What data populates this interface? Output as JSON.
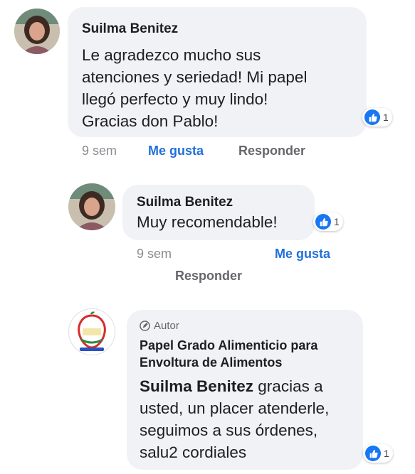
{
  "comments": [
    {
      "author": "Suilma Benitez",
      "lines": [
        "Le agradezco mucho sus",
        "atenciones y seriedad! Mi papel",
        "llegó perfecto y muy lindo!",
        "Gracias don Pablo!"
      ],
      "reaction_count": "1",
      "time": "9 sem",
      "like_label": "Me gusta",
      "reply_label": "Responder"
    },
    {
      "author": "Suilma Benitez",
      "lines": [
        "Muy recomendable!"
      ],
      "reaction_count": "1",
      "time": "9 sem",
      "like_label": "Me gusta",
      "reply_label": "Responder"
    },
    {
      "badge": "Autor",
      "author_lines": [
        "Papel Grado Alimenticio para",
        "Envoltura de Alimentos"
      ],
      "mention": "Suilma Benitez",
      "lines": [
        " gracias a",
        "usted, un placer atenderle,",
        "seguimos a sus órdenes,",
        "salu2 cordiales"
      ],
      "reaction_count": "1"
    }
  ],
  "colors": {
    "bubble": "#f0f2f5",
    "like": "#216fdb",
    "reaction": "#1877f2"
  },
  "icons": [
    "like-reaction-icon",
    "author-badge-icon",
    "avatar",
    "page-logo-avatar"
  ]
}
